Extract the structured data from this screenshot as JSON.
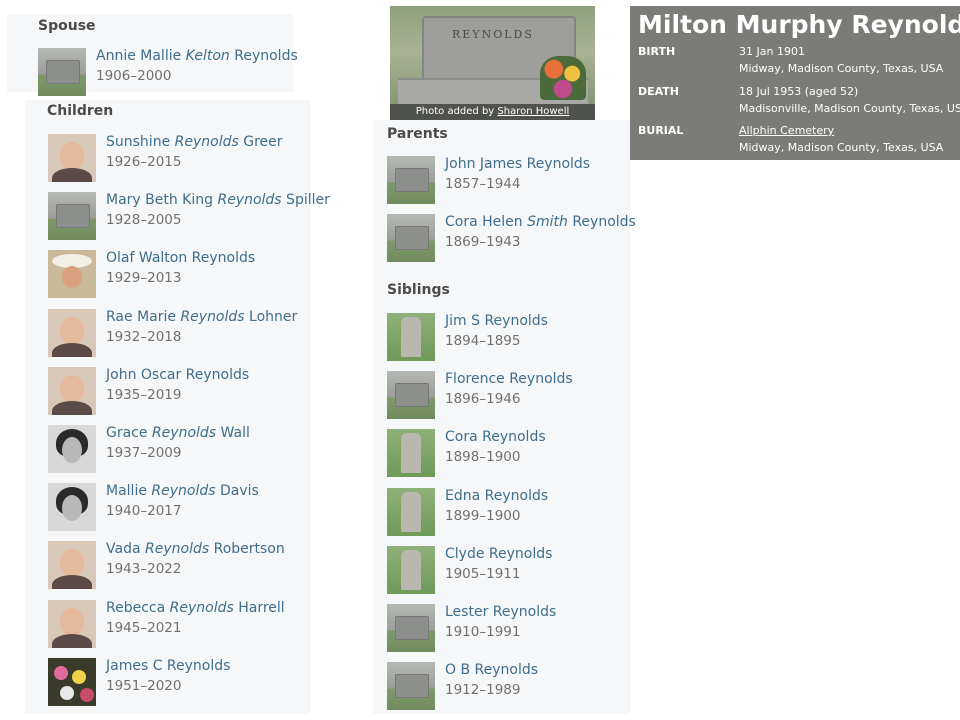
{
  "person": {
    "name": "Milton Murphy Reynolds",
    "photo_caption_prefix": "Photo added by ",
    "photo_caption_author": "Sharon Howell",
    "headstone_text": "REYNOLDS",
    "facts": {
      "birth": {
        "label": "BIRTH",
        "date": "31 Jan 1901",
        "place": "Midway, Madison County, Texas, USA"
      },
      "death": {
        "label": "DEATH",
        "date": "18 Jul 1953 (aged 52)",
        "place": "Madisonville, Madison County, Texas, USA"
      },
      "burial": {
        "label": "BURIAL",
        "cemetery": "Allphin Cemetery",
        "place": "Midway, Madison County, Texas, USA"
      }
    }
  },
  "spouse": {
    "heading": "Spouse",
    "items": [
      {
        "first": "Annie Mallie ",
        "maiden": "Kelton",
        "last": " Reynolds",
        "dates": "1906–2000",
        "thumb": "headstone"
      }
    ]
  },
  "children": {
    "heading": "Children",
    "items": [
      {
        "first": "Sunshine ",
        "maiden": "Reynolds",
        "last": " Greer",
        "dates": "1926–2015",
        "thumb": "portrait"
      },
      {
        "first": "Mary Beth King ",
        "maiden": "Reynolds",
        "last": " Spiller",
        "dates": "1928–2005",
        "thumb": "headstone"
      },
      {
        "first": "Olaf Walton Reynolds",
        "maiden": "",
        "last": "",
        "dates": "1929–2013",
        "thumb": "portrait-cowboy-hat"
      },
      {
        "first": "Rae Marie ",
        "maiden": "Reynolds",
        "last": " Lohner",
        "dates": "1932–2018",
        "thumb": "portrait"
      },
      {
        "first": "John Oscar Reynolds",
        "maiden": "",
        "last": "",
        "dates": "1935–2019",
        "thumb": "portrait"
      },
      {
        "first": "Grace ",
        "maiden": "Reynolds",
        "last": " Wall",
        "dates": "1937–2009",
        "thumb": "portrait-bw"
      },
      {
        "first": "Mallie ",
        "maiden": "Reynolds",
        "last": " Davis",
        "dates": "1940–2017",
        "thumb": "portrait-bw"
      },
      {
        "first": "Vada ",
        "maiden": "Reynolds",
        "last": " Robertson",
        "dates": "1943–2022",
        "thumb": "portrait"
      },
      {
        "first": "Rebecca ",
        "maiden": "Reynolds",
        "last": " Harrell",
        "dates": "1945–2021",
        "thumb": "portrait"
      },
      {
        "first": "James C Reynolds",
        "maiden": "",
        "last": "",
        "dates": "1951–2020",
        "thumb": "flowers"
      }
    ]
  },
  "parents": {
    "heading": "Parents",
    "items": [
      {
        "first": "John James Reynolds",
        "maiden": "",
        "last": "",
        "dates": "1857–1944",
        "thumb": "headstone"
      },
      {
        "first": "Cora Helen ",
        "maiden": "Smith",
        "last": " Reynolds",
        "dates": "1869–1943",
        "thumb": "headstone"
      }
    ]
  },
  "siblings": {
    "heading": "Siblings",
    "items": [
      {
        "first": "Jim S Reynolds",
        "maiden": "",
        "last": "",
        "dates": "1894–1895",
        "thumb": "headstone-tall"
      },
      {
        "first": "Florence Reynolds",
        "maiden": "",
        "last": "",
        "dates": "1896–1946",
        "thumb": "headstone"
      },
      {
        "first": "Cora Reynolds",
        "maiden": "",
        "last": "",
        "dates": "1898–1900",
        "thumb": "headstone-tall"
      },
      {
        "first": "Edna Reynolds",
        "maiden": "",
        "last": "",
        "dates": "1899–1900",
        "thumb": "headstone-tall"
      },
      {
        "first": "Clyde Reynolds",
        "maiden": "",
        "last": "",
        "dates": "1905–1911",
        "thumb": "headstone-tall"
      },
      {
        "first": "Lester Reynolds",
        "maiden": "",
        "last": "",
        "dates": "1910–1991",
        "thumb": "headstone"
      },
      {
        "first": "O B Reynolds",
        "maiden": "",
        "last": "",
        "dates": "1912–1989",
        "thumb": "headstone"
      }
    ]
  },
  "colors": {
    "link": "#3e6e8c",
    "muted": "#707070",
    "panel_bg": "#f6f7f8",
    "facts_bg": "#7b7c78"
  }
}
